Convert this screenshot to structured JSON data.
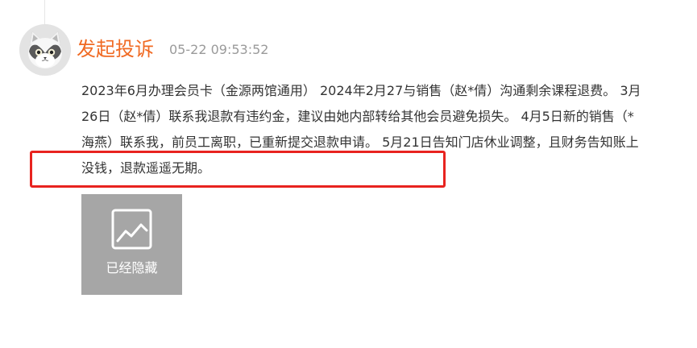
{
  "post": {
    "author": "发起投诉",
    "time": "05-22 09:53:52",
    "avatar_icon": "cat-avatar-icon",
    "content": "2023年6月办理会员卡（金源两馆通用） 2024年2月27与销售（赵*倩）沟通剩余课程退费。 3月26日（赵*倩）联系我退款有违约金，建议由她内部转给其他会员避免损失。 4月5日新的销售（*海燕）联系我，前员工离职，已重新提交退款申请。 5月21日告知门店休业调整，且财务告知账上没钱，退款遥遥无期。",
    "attachment": {
      "icon": "image-placeholder-icon",
      "label": "已经隐藏"
    }
  },
  "colors": {
    "author": "#f06a23",
    "highlight": "#e8231f",
    "attachment_bg": "#a6a6a6"
  }
}
